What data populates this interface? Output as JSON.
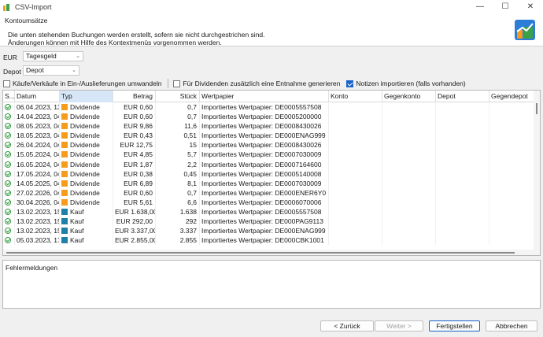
{
  "window": {
    "title": "CSV-Import",
    "controls": {
      "minimize": "—",
      "maximize": "☐",
      "close": "✕"
    }
  },
  "header": {
    "title": "Kontoumsätze",
    "desc_line1": "Die unten stehenden Buchungen werden erstellt, sofern sie nicht durchgestrichen sind.",
    "desc_line2": "Änderungen können mit Hilfe des Kontextmenüs vorgenommen werden."
  },
  "account": {
    "label": "EUR",
    "value": "Tagesgeld"
  },
  "depot": {
    "label": "Depot",
    "value": "Depot"
  },
  "options": [
    {
      "label": "Käufe/Verkäufe in Ein-/Auslieferungen umwandeln",
      "checked": false
    },
    {
      "label": "Für Dividenden zusätzlich eine Entnahme generieren",
      "checked": false
    },
    {
      "label": "Notizen importieren (falls vorhanden)",
      "checked": true
    }
  ],
  "table": {
    "columns": [
      "S...",
      "Datum",
      "Typ",
      "Betrag",
      "Stück",
      "Wertpapier",
      "Konto",
      "Gegenkonto",
      "Depot",
      "Gegendepot"
    ],
    "rows": [
      {
        "date": "06.04.2023, 13",
        "type": "Dividende",
        "amount": "EUR 0,60",
        "shares": "0,7",
        "security": "Importiertes Wertpapier: DE0005557508"
      },
      {
        "date": "14.04.2023, 04",
        "type": "Dividende",
        "amount": "EUR 0,60",
        "shares": "0,7",
        "security": "Importiertes Wertpapier: DE0005200000"
      },
      {
        "date": "08.05.2023, 04",
        "type": "Dividende",
        "amount": "EUR 9,86",
        "shares": "11,6",
        "security": "Importiertes Wertpapier: DE0008430026"
      },
      {
        "date": "18.05.2023, 04",
        "type": "Dividende",
        "amount": "EUR 0,43",
        "shares": "0,51",
        "security": "Importiertes Wertpapier: DE000ENAG999"
      },
      {
        "date": "26.04.2024, 04",
        "type": "Dividende",
        "amount": "EUR 12,75",
        "shares": "15",
        "security": "Importiertes Wertpapier: DE0008430026"
      },
      {
        "date": "15.05.2024, 04",
        "type": "Dividende",
        "amount": "EUR 4,85",
        "shares": "5,7",
        "security": "Importiertes Wertpapier: DE0007030009"
      },
      {
        "date": "16.05.2024, 04",
        "type": "Dividende",
        "amount": "EUR 1,87",
        "shares": "2,2",
        "security": "Importiertes Wertpapier: DE0007164600"
      },
      {
        "date": "17.05.2024, 04",
        "type": "Dividende",
        "amount": "EUR 0,38",
        "shares": "0,45",
        "security": "Importiertes Wertpapier: DE0005140008"
      },
      {
        "date": "14.05.2025, 04",
        "type": "Dividende",
        "amount": "EUR 6,89",
        "shares": "8,1",
        "security": "Importiertes Wertpapier: DE0007030009"
      },
      {
        "date": "27.02.2026, 04",
        "type": "Dividende",
        "amount": "EUR 0,60",
        "shares": "0,7",
        "security": "Importiertes Wertpapier: DE000ENER6Y0"
      },
      {
        "date": "30.04.2026, 04",
        "type": "Dividende",
        "amount": "EUR 5,61",
        "shares": "6,6",
        "security": "Importiertes Wertpapier: DE0006070006"
      },
      {
        "date": "13.02.2023, 15",
        "type": "Kauf",
        "amount": "EUR 1.638,00",
        "shares": "1.638",
        "security": "Importiertes Wertpapier: DE0005557508"
      },
      {
        "date": "13.02.2023, 15",
        "type": "Kauf",
        "amount": "EUR 292,00",
        "shares": "292",
        "security": "Importiertes Wertpapier: DE000PAG9113"
      },
      {
        "date": "13.02.2023, 15",
        "type": "Kauf",
        "amount": "EUR 3.337,00",
        "shares": "3.337",
        "security": "Importiertes Wertpapier: DE000ENAG999"
      },
      {
        "date": "05.03.2023, 17",
        "type": "Kauf",
        "amount": "EUR 2.855,00",
        "shares": "2.855",
        "security": "Importiertes Wertpapier: DE000CBK1001"
      }
    ]
  },
  "errors": {
    "title": "Fehlermeldungen"
  },
  "buttons": {
    "back": "< Zurück",
    "next": "Weiter >",
    "finish": "Fertigstellen",
    "cancel": "Abbrechen"
  },
  "colors": {
    "dividend_icon": "#f59c1a",
    "buy_icon": "#1e7fa8",
    "status_ok": "#2f9a3e",
    "selected_header": "#d6e6f7",
    "checkbox_on": "#1a62c9"
  },
  "icons": {
    "status": "check-circle-icon",
    "dividend": "dividend-icon",
    "buy": "buy-icon"
  }
}
